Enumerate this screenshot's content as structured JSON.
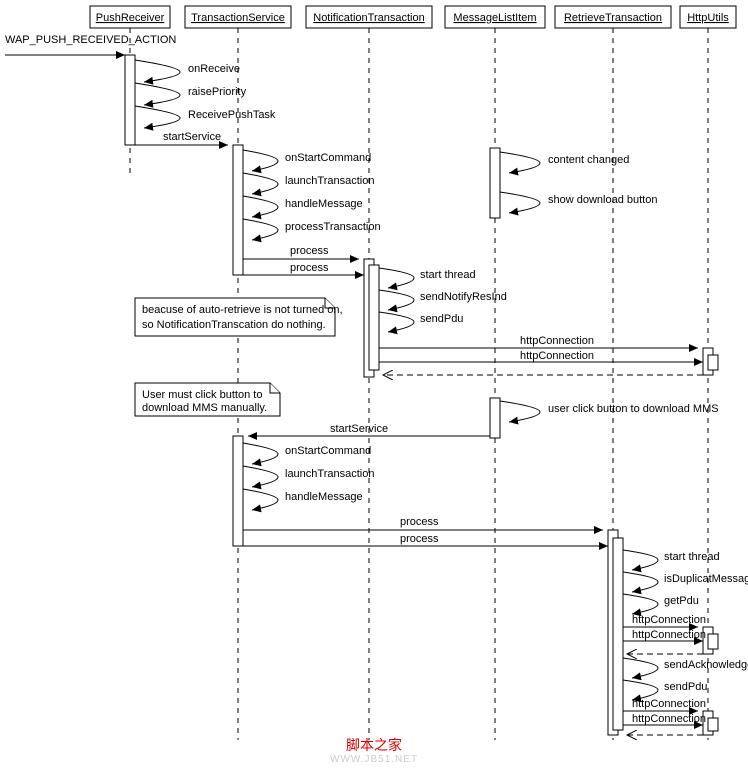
{
  "chart_data": {
    "type": "sequence-diagram",
    "title": "",
    "participants": [
      "PushReceiver",
      "TransactionService",
      "NotificationTransaction",
      "MessageListItem",
      "RetrieveTransaction",
      "HttpUtils"
    ],
    "external_trigger": "WAP_PUSH_RECEIVED_ACTION",
    "messages": [
      {
        "from": "PushReceiver",
        "to": "PushReceiver",
        "label": "onReceive",
        "type": "self"
      },
      {
        "from": "PushReceiver",
        "to": "PushReceiver",
        "label": "raisePriority",
        "type": "self"
      },
      {
        "from": "PushReceiver",
        "to": "PushReceiver",
        "label": "ReceivePushTask",
        "type": "self"
      },
      {
        "from": "PushReceiver",
        "to": "TransactionService",
        "label": "startService",
        "type": "sync"
      },
      {
        "from": "TransactionService",
        "to": "TransactionService",
        "label": "onStartCommand",
        "type": "self"
      },
      {
        "from": "MessageListItem",
        "to": "MessageListItem",
        "label": "content changed",
        "type": "self"
      },
      {
        "from": "TransactionService",
        "to": "TransactionService",
        "label": "launchTransaction",
        "type": "self"
      },
      {
        "from": "TransactionService",
        "to": "TransactionService",
        "label": "handleMessage",
        "type": "self"
      },
      {
        "from": "MessageListItem",
        "to": "MessageListItem",
        "label": "show download button",
        "type": "self"
      },
      {
        "from": "TransactionService",
        "to": "TransactionService",
        "label": "processTransaction",
        "type": "self"
      },
      {
        "from": "TransactionService",
        "to": "NotificationTransaction",
        "label": "process",
        "type": "sync"
      },
      {
        "from": "NotificationTransaction",
        "to": "NotificationTransaction",
        "label": "process",
        "type": "sync-inner"
      },
      {
        "from": "NotificationTransaction",
        "to": "NotificationTransaction",
        "label": "start thread",
        "type": "self"
      },
      {
        "from": "NotificationTransaction",
        "to": "NotificationTransaction",
        "label": "sendNotifyResInd",
        "type": "self"
      },
      {
        "from": "NotificationTransaction",
        "to": "NotificationTransaction",
        "label": "sendPdu",
        "type": "self"
      },
      {
        "from": "NotificationTransaction",
        "to": "HttpUtils",
        "label": "httpConnection",
        "type": "sync"
      },
      {
        "from": "HttpUtils",
        "to": "HttpUtils",
        "label": "httpConnection",
        "type": "sync-inner"
      },
      {
        "from": "HttpUtils",
        "to": "NotificationTransaction",
        "label": "",
        "type": "return"
      },
      {
        "from": "MessageListItem",
        "to": "MessageListItem",
        "label": "user click button to download MMS",
        "type": "self"
      },
      {
        "from": "MessageListItem",
        "to": "TransactionService",
        "label": "startService",
        "type": "sync"
      },
      {
        "from": "TransactionService",
        "to": "TransactionService",
        "label": "onStartCommand",
        "type": "self"
      },
      {
        "from": "TransactionService",
        "to": "TransactionService",
        "label": "launchTransaction",
        "type": "self"
      },
      {
        "from": "TransactionService",
        "to": "TransactionService",
        "label": "handleMessage",
        "type": "self"
      },
      {
        "from": "TransactionService",
        "to": "RetrieveTransaction",
        "label": "process",
        "type": "sync"
      },
      {
        "from": "RetrieveTransaction",
        "to": "RetrieveTransaction",
        "label": "process",
        "type": "sync-inner"
      },
      {
        "from": "RetrieveTransaction",
        "to": "RetrieveTransaction",
        "label": "start thread",
        "type": "self"
      },
      {
        "from": "RetrieveTransaction",
        "to": "RetrieveTransaction",
        "label": "isDuplicatMessage",
        "type": "self"
      },
      {
        "from": "RetrieveTransaction",
        "to": "RetrieveTransaction",
        "label": "getPdu",
        "type": "self"
      },
      {
        "from": "RetrieveTransaction",
        "to": "HttpUtils",
        "label": "httpConnection",
        "type": "sync"
      },
      {
        "from": "HttpUtils",
        "to": "HttpUtils",
        "label": "httpConnection",
        "type": "sync-inner"
      },
      {
        "from": "HttpUtils",
        "to": "RetrieveTransaction",
        "label": "",
        "type": "return"
      },
      {
        "from": "RetrieveTransaction",
        "to": "RetrieveTransaction",
        "label": "sendAcknowledgeInd",
        "type": "self"
      },
      {
        "from": "RetrieveTransaction",
        "to": "RetrieveTransaction",
        "label": "sendPdu",
        "type": "self"
      },
      {
        "from": "RetrieveTransaction",
        "to": "HttpUtils",
        "label": "httpConnection",
        "type": "sync"
      },
      {
        "from": "HttpUtils",
        "to": "HttpUtils",
        "label": "httpConnection",
        "type": "sync-inner"
      },
      {
        "from": "HttpUtils",
        "to": "RetrieveTransaction",
        "label": "",
        "type": "return"
      }
    ],
    "notes": [
      {
        "text": "beacuse of auto-retrieve is not turned on, so NotificationTranscation do nothing.",
        "attached": "NotificationTransaction"
      },
      {
        "text": "User must click button to download MMS manually.",
        "attached": "MessageListItem"
      }
    ]
  },
  "participants": {
    "p0": "PushReceiver",
    "p1": "TransactionService",
    "p2": "NotificationTransaction",
    "p3": "MessageListItem",
    "p4": "RetrieveTransaction",
    "p5": "HttpUtils"
  },
  "trigger": "WAP_PUSH_RECEIVED_ACTION",
  "labels": {
    "onReceive": "onReceive",
    "raisePriority": "raisePriority",
    "ReceivePushTask": "ReceivePushTask",
    "startService": "startService",
    "onStartCommand": "onStartCommand",
    "launchTransaction": "launchTransaction",
    "handleMessage": "handleMessage",
    "processTransaction": "processTransaction",
    "process": "process",
    "contentChanged": "content changed",
    "showDownloadButton": "show download button",
    "startThread": "start thread",
    "sendNotifyResInd": "sendNotifyResInd",
    "sendPdu": "sendPdu",
    "httpConnection": "httpConnection",
    "userClick": "user click button to download MMS",
    "isDuplicatMessage": "isDuplicatMessage",
    "getPdu": "getPdu",
    "sendAcknowledgeInd": "sendAcknowledgeInd"
  },
  "notes": {
    "n1a": "beacuse of auto-retrieve is not turned on,",
    "n1b": "so NotificationTranscation do nothing.",
    "n2a": "User must click button to",
    "n2b": "download MMS manually."
  },
  "watermark": {
    "line1": "脚本之家",
    "line2": "WWW.JB51.NET"
  }
}
